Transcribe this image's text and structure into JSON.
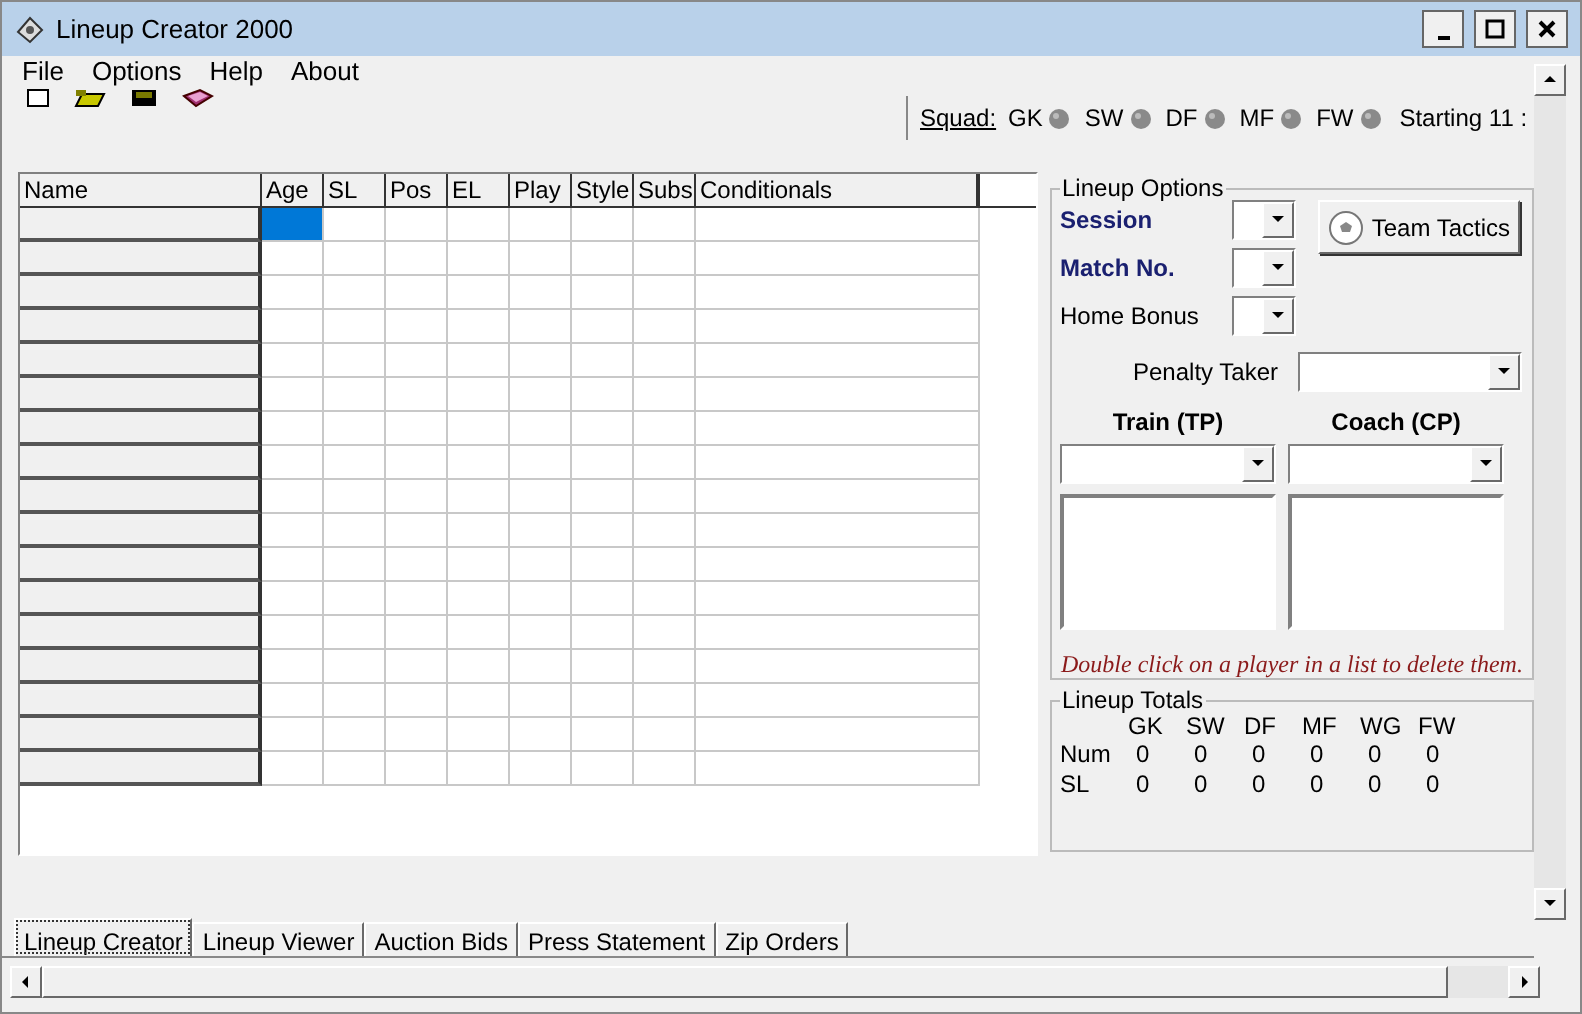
{
  "window": {
    "title": "Lineup Creator 2000"
  },
  "menu": [
    "File",
    "Options",
    "Help",
    "About"
  ],
  "toolbar": [
    {
      "kind": "new"
    },
    {
      "kind": "open"
    },
    {
      "kind": "save"
    },
    {
      "kind": "book"
    }
  ],
  "squad": {
    "label": "Squad:",
    "positions": [
      "GK",
      "SW",
      "DF",
      "MF",
      "FW"
    ],
    "starting": "Starting 11 :"
  },
  "grid": {
    "columns": [
      "Name",
      "Age",
      "SL",
      "Pos",
      "EL",
      "Play",
      "Style",
      "Subs",
      "Conditionals"
    ],
    "rows": [
      {
        "selected": true
      },
      {
        "selected": false
      },
      {
        "selected": false
      },
      {
        "selected": false
      },
      {
        "selected": false
      },
      {
        "selected": false
      },
      {
        "selected": false
      },
      {
        "selected": false
      },
      {
        "selected": false
      },
      {
        "selected": false
      },
      {
        "selected": false
      },
      {
        "selected": false
      },
      {
        "selected": false
      },
      {
        "selected": false
      },
      {
        "selected": false
      },
      {
        "selected": false
      },
      {
        "selected": false
      }
    ]
  },
  "lineup_options": {
    "title": "Lineup Options",
    "session": "Session",
    "match_no": "Match No.",
    "home_bonus": "Home Bonus",
    "team_tactics": "Team Tactics",
    "penalty_taker": "Penalty Taker",
    "train": "Train (TP)",
    "coach": "Coach (CP)",
    "hint": "Double click on a player in a list to delete them."
  },
  "lineup_totals": {
    "title": "Lineup Totals",
    "columns": [
      "GK",
      "SW",
      "DF",
      "MF",
      "WG",
      "FW"
    ],
    "rows": [
      {
        "label": "Num",
        "values": [
          "0",
          "0",
          "0",
          "0",
          "0",
          "0"
        ]
      },
      {
        "label": "SL",
        "values": [
          "0",
          "0",
          "0",
          "0",
          "0",
          "0"
        ]
      }
    ]
  },
  "tabs": [
    {
      "label": "Lineup Creator",
      "selected": true
    },
    {
      "label": "Lineup Viewer",
      "selected": false
    },
    {
      "label": "Auction Bids",
      "selected": false
    },
    {
      "label": "Press Statement",
      "selected": false
    },
    {
      "label": "Zip Orders",
      "selected": false
    }
  ]
}
